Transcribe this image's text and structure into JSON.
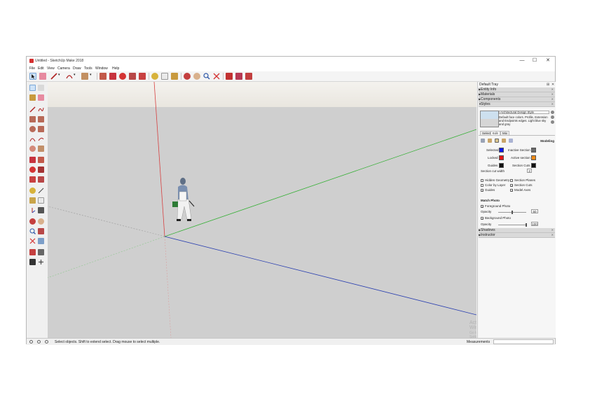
{
  "window": {
    "title": "Untitled - SketchUp Make 2018",
    "controls": {
      "minimize": "—",
      "maximize": "☐",
      "close": "✕"
    }
  },
  "menu": [
    "File",
    "Edit",
    "View",
    "Camera",
    "Draw",
    "Tools",
    "Window",
    "Help"
  ],
  "toolbar": {
    "icons": [
      "select-icon",
      "eraser-icon",
      "line-icon",
      "arc-icon",
      "shape-icon",
      "push-pull-icon",
      "move-icon",
      "rotate-icon",
      "scale-icon",
      "offset-icon",
      "tape-measure-icon",
      "text-icon",
      "paint-bucket-icon",
      "orbit-icon",
      "pan-icon",
      "zoom-icon",
      "zoom-extents-icon",
      "warehouse-icon",
      "extension-warehouse-icon",
      "share-model-icon"
    ]
  },
  "viewport": {
    "watermark_title": "Activate Windows",
    "watermark_sub": "Go to Settings to activate Windows.",
    "colors": {
      "sky": "#ece9e2",
      "ground": "#cfcfcf",
      "red_axis": "#d64040",
      "green_axis": "#36b036",
      "blue_axis": "#2a3fb0"
    }
  },
  "tray": {
    "title": "Default Tray",
    "controls": {
      "pin": "⊞",
      "close": "✕"
    },
    "sections": {
      "entity_info": "Entity Info",
      "materials": "Materials",
      "components": "Components",
      "styles": "Styles",
      "shadows": "Shadows",
      "instructor": "Instructor"
    },
    "styles": {
      "name": "Architectural Design Style",
      "description": "Default face colors. Profile, Extension and Endpoints edges. Light blue sky and gray",
      "tabs": [
        "Select",
        "Edit",
        "Mix"
      ],
      "active_tab": "Edit",
      "mode_label": "Modeling",
      "colors": {
        "selected": {
          "label": "Selected",
          "color": "#0b18ef"
        },
        "locked": {
          "label": "Locked",
          "color": "#e31717"
        },
        "guides": {
          "label": "Guides",
          "color": "#111111"
        },
        "inactive_section": {
          "label": "Inactive Section",
          "color": "#6a6a6a"
        },
        "active_section": {
          "label": "Active section",
          "color": "#ef8a16"
        },
        "section_cuts": {
          "label": "Section Cuts",
          "color": "#111111"
        }
      },
      "section_cut_width_label": "Section cut width",
      "section_cut_width": "3",
      "checkboxes": {
        "hidden_geometry": {
          "label": "Hidden Geometry",
          "checked": false
        },
        "color_by_layer": {
          "label": "Color by Layer",
          "checked": false
        },
        "guides": {
          "label": "Guides",
          "checked": true
        },
        "section_planes": {
          "label": "Section Planes",
          "checked": false
        },
        "section_cuts": {
          "label": "Section Cuts",
          "checked": true
        },
        "model_axes": {
          "label": "Model Axes",
          "checked": true
        }
      },
      "watermark_heading": "Match Photo",
      "foreground_photo": {
        "label": "Foreground Photo",
        "checked": true
      },
      "background_photo": {
        "label": "Background Photo",
        "checked": true
      },
      "opacity_label": "Opacity",
      "foreground_opacity": "50",
      "background_opacity": "100"
    }
  },
  "status": {
    "text": "Select objects. Shift to extend select. Drag mouse to select multiple.",
    "measurements_label": "Measurements",
    "measurements_value": ""
  }
}
